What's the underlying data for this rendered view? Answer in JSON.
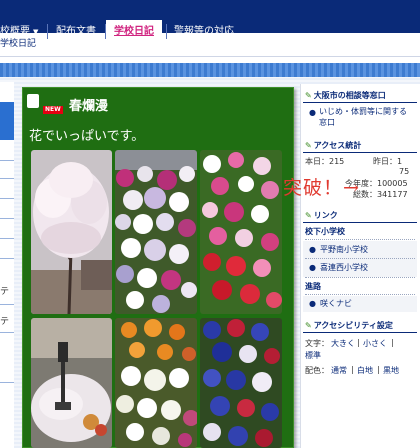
{
  "nav": {
    "items": [
      {
        "label": "校概要",
        "has_dropdown": true
      },
      {
        "label": "配布文書"
      },
      {
        "label": "学校日記",
        "active": true
      },
      {
        "label": "警報等の対応"
      }
    ]
  },
  "breadcrumb": "学校日記",
  "left_partial": [
    "テ",
    "テ"
  ],
  "blog": {
    "badge": "NEW",
    "title": "春爛漫",
    "subtitle": "花でいっぱいです。"
  },
  "sidebar": {
    "consult": {
      "title": "大阪市の相談等窓口",
      "items": [
        "いじめ・体罰等に関する窓口"
      ]
    },
    "access": {
      "title": "アクセス統計",
      "today_label": "本日：215",
      "yesterday_label": "昨日：1",
      "yesterday_cont": "75",
      "year_label": "今年度：100005",
      "total_label": "総数：341177"
    },
    "links": {
      "title": "リンク",
      "group1": "校下小学校",
      "group1_items": [
        "平野南小学校",
        "喜連西小学校"
      ],
      "group2": "進路",
      "group2_items": [
        "咲くナビ"
      ]
    },
    "accessibility": {
      "title": "アクセシビリティ設定",
      "text_prefix": "文字：",
      "text_opts": [
        "大きく",
        "小さく",
        "標準"
      ],
      "color_prefix": "配色：",
      "color_opts": [
        "通常",
        "白地",
        "黒地"
      ]
    }
  },
  "annotation": "突破！→",
  "colors": {
    "nav_bg": "#0a2a78",
    "active_tab_text": "#d0237f",
    "blog_bg": "#1f6e12",
    "annotation": "#e03a30"
  }
}
